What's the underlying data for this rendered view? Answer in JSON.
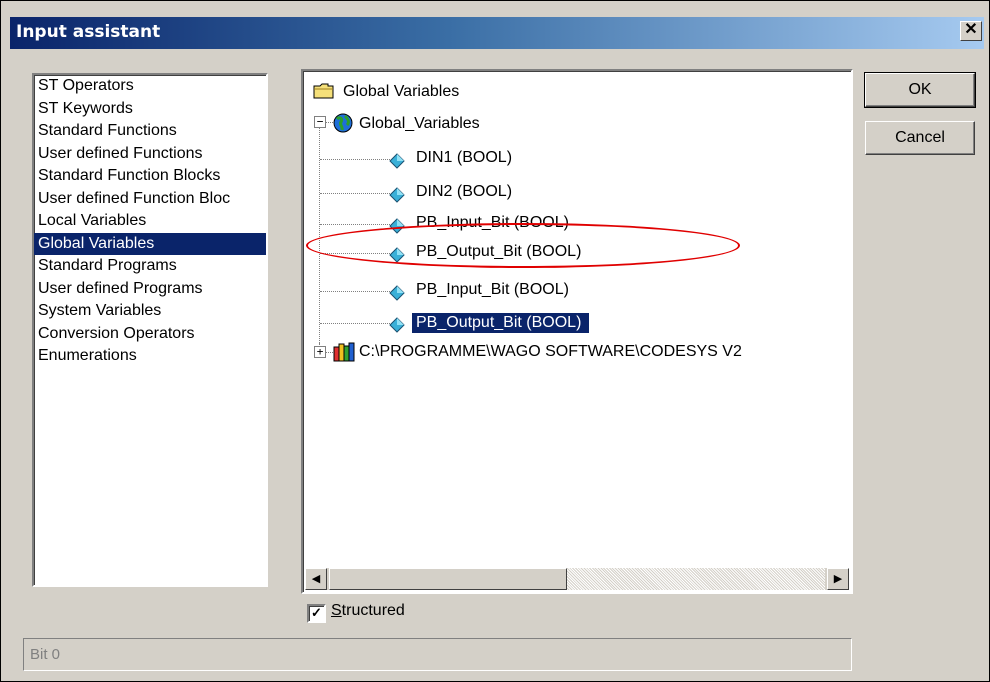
{
  "window": {
    "title": "Input assistant",
    "close_glyph": "✕"
  },
  "categories": [
    {
      "label": "ST Operators",
      "selected": false
    },
    {
      "label": "ST Keywords",
      "selected": false
    },
    {
      "label": "Standard Functions",
      "selected": false
    },
    {
      "label": "User defined Functions",
      "selected": false
    },
    {
      "label": "Standard Function Blocks",
      "selected": false
    },
    {
      "label": "User defined Function Bloc",
      "selected": false
    },
    {
      "label": "Local Variables",
      "selected": false
    },
    {
      "label": "Global Variables",
      "selected": true
    },
    {
      "label": "Standard Programs",
      "selected": false
    },
    {
      "label": "User defined Programs",
      "selected": false
    },
    {
      "label": "System Variables",
      "selected": false
    },
    {
      "label": "Conversion Operators",
      "selected": false
    },
    {
      "label": "Enumerations",
      "selected": false
    }
  ],
  "tree": {
    "root_label": "Global Variables",
    "group_label": "Global_Variables",
    "group_expander": "−",
    "items": [
      {
        "label": "DIN1 (BOOL)"
      },
      {
        "label": "DIN2 (BOOL)"
      },
      {
        "label": "PB_Input_Bit (BOOL)"
      },
      {
        "label": "PB_Output_Bit (BOOL)"
      },
      {
        "label": "PB_Input_Bit (BOOL)"
      },
      {
        "label": "PB_Output_Bit (BOOL)",
        "selected": true
      }
    ],
    "library_label": "C:\\PROGRAMME\\WAGO SOFTWARE\\CODESYS V2",
    "library_expander": "+"
  },
  "buttons": {
    "ok": "OK",
    "cancel": "Cancel"
  },
  "structured": {
    "label_first": "S",
    "label_rest": "tructured",
    "checked": true,
    "check_glyph": "✓"
  },
  "status_text": "Bit 0",
  "scrollbar": {
    "left_arrow": "◀",
    "right_arrow": "▶"
  },
  "colors": {
    "selection": "#0a246a",
    "annotation": "#e00000"
  },
  "icons": [
    "folder-icon",
    "globe-icon",
    "variable-icon",
    "library-icon"
  ]
}
